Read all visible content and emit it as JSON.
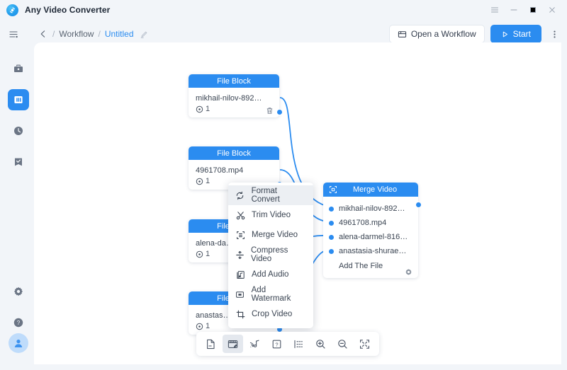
{
  "window": {
    "app_title": "Any Video Converter",
    "logo_icon": "app-logo-icon",
    "controls": [
      {
        "name": "menu-icon",
        "label": "≡"
      },
      {
        "name": "minimize-icon",
        "label": "–"
      },
      {
        "name": "maximize-icon",
        "label": "□"
      },
      {
        "name": "close-icon",
        "label": "×"
      }
    ]
  },
  "toolbar": {
    "sidebar_toggle_icon": "sidebar-toggle-icon",
    "back_icon": "back-arrow-icon",
    "separator": "/",
    "breadcrumb_workflow": "Workflow",
    "breadcrumb_separator": "/",
    "breadcrumb_current": "Untitled",
    "rename_icon": "edit-pencil-icon",
    "open_workflow_label": "Open a Workflow",
    "open_workflow_icon": "folder-open-icon",
    "start_label": "Start",
    "start_icon": "play-icon",
    "more_icon": "kebab-more-icon"
  },
  "sidebar": {
    "items": [
      {
        "name": "sidebar-item-toolbox",
        "icon": "toolbox-icon",
        "selected": false
      },
      {
        "name": "sidebar-item-workflow",
        "icon": "workflow-columns-icon",
        "selected": true
      },
      {
        "name": "sidebar-item-history",
        "icon": "clock-history-icon",
        "selected": false
      },
      {
        "name": "sidebar-item-tasks",
        "icon": "task-checked-icon",
        "selected": false
      }
    ],
    "bottom_items": [
      {
        "name": "sidebar-item-settings",
        "icon": "gear-icon"
      },
      {
        "name": "sidebar-item-help",
        "icon": "help-circle-icon"
      }
    ],
    "avatar_icon": "user-avatar-icon"
  },
  "canvas": {
    "file_blocks": [
      {
        "title": "File Block",
        "filename": "mikhail-nilov-892…",
        "count": "1",
        "count_icon": "play-count-icon",
        "delete_icon": "trash-icon",
        "has_delete": true
      },
      {
        "title": "File Block",
        "filename": "4961708.mp4",
        "count": "1",
        "count_icon": "play-count-icon",
        "has_delete": false
      },
      {
        "title": "File Block",
        "filename": "alena-da…",
        "count": "1",
        "count_icon": "play-count-icon",
        "has_delete": false
      },
      {
        "title": "File Block",
        "filename": "anastas…",
        "count": "1",
        "count_icon": "play-count-icon",
        "has_delete": false
      }
    ],
    "merge_node": {
      "title": "Merge Video",
      "title_icon": "merge-video-icon",
      "files": [
        "mikhail-nilov-892…",
        "4961708.mp4",
        "alena-darmel-816…",
        "anastasia-shurae…"
      ],
      "add_file_label": "Add The File",
      "settings_icon": "gear-icon"
    },
    "edge_color": "#2b8cf0"
  },
  "context_menu": {
    "items": [
      {
        "label": "Format Convert",
        "icon": "format-convert-icon",
        "highlighted": true
      },
      {
        "label": "Trim Video",
        "icon": "scissors-icon",
        "highlighted": false
      },
      {
        "label": "Merge Video",
        "icon": "merge-video-icon",
        "highlighted": false
      },
      {
        "label": "Compress Video",
        "icon": "compress-icon",
        "highlighted": false
      },
      {
        "label": "Add Audio",
        "icon": "add-audio-icon",
        "highlighted": false
      },
      {
        "label": "Add Watermark",
        "icon": "watermark-icon",
        "highlighted": false
      },
      {
        "label": "Crop Video",
        "icon": "crop-icon",
        "highlighted": false
      }
    ]
  },
  "bottom_toolbar": {
    "items": [
      {
        "name": "add-file-block-button",
        "icon": "file-minus-icon",
        "active": false
      },
      {
        "name": "video-tool-button",
        "icon": "video-edit-icon",
        "active": true
      },
      {
        "name": "audio-tool-button",
        "icon": "audio-note-icon",
        "active": false
      },
      {
        "name": "help-tool-button",
        "icon": "question-box-icon",
        "active": false
      },
      {
        "name": "list-tool-button",
        "icon": "list-icon",
        "active": false
      },
      {
        "name": "zoom-in-button",
        "icon": "zoom-in-icon",
        "active": false
      },
      {
        "name": "zoom-out-button",
        "icon": "zoom-out-icon",
        "active": false
      },
      {
        "name": "fit-screen-button",
        "icon": "fit-screen-icon",
        "active": false
      }
    ]
  },
  "colors": {
    "accent": "#2b8cf0",
    "canvas_bg": "#ffffff",
    "app_bg": "#f2f5f9"
  }
}
